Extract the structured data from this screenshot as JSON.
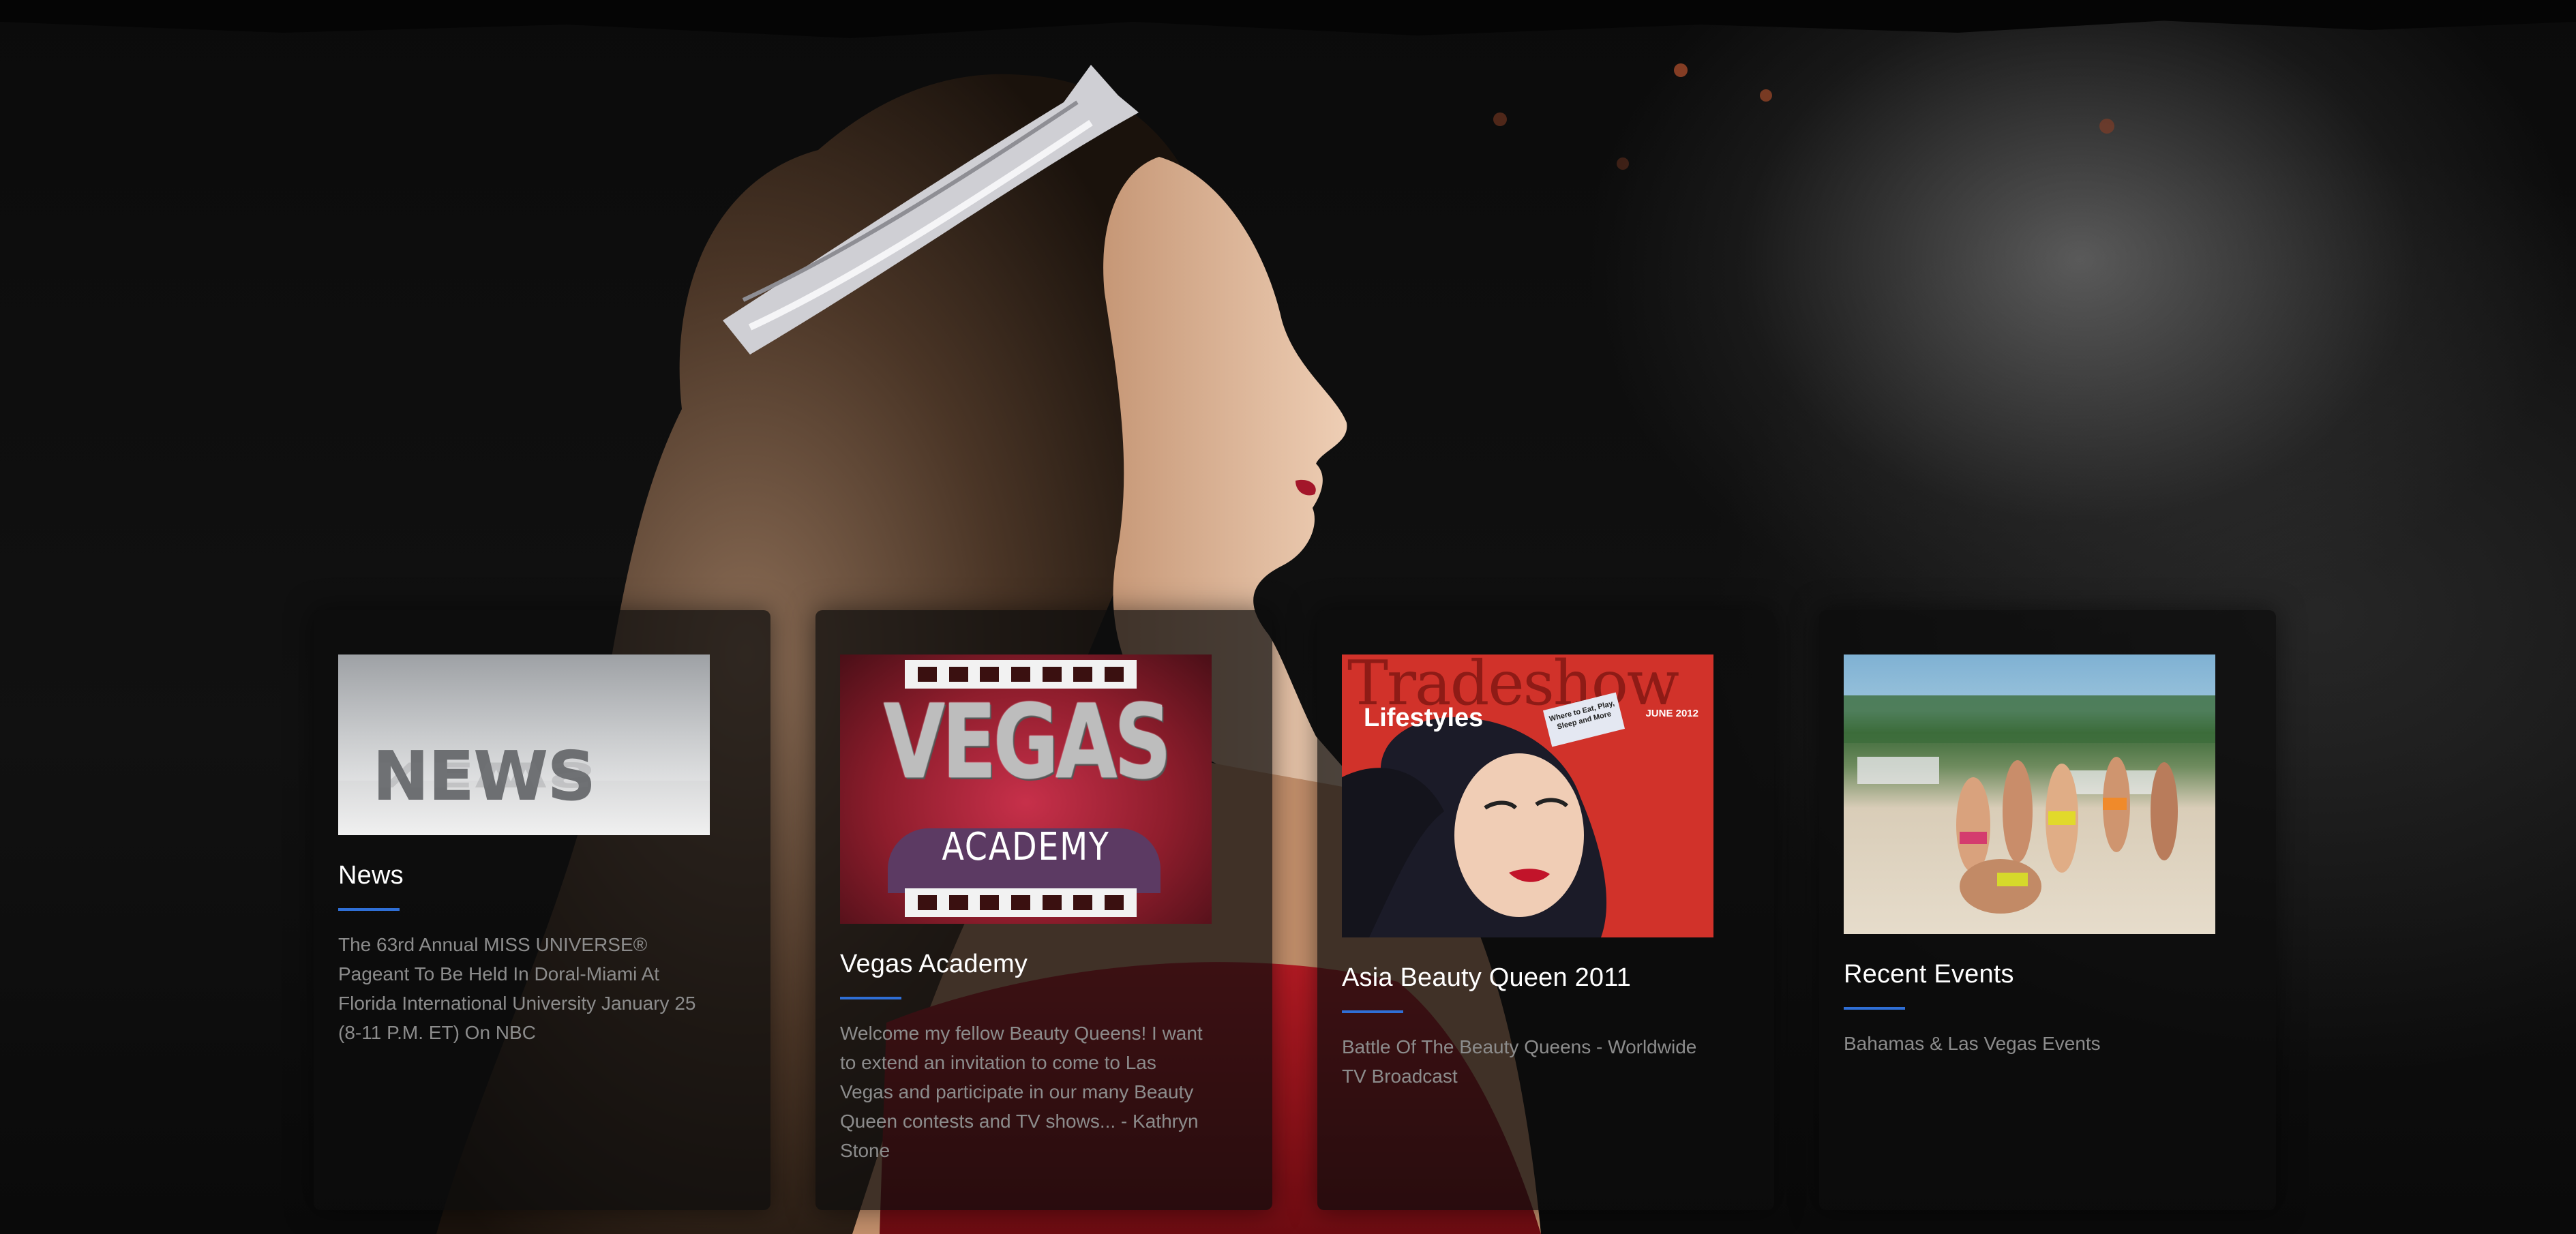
{
  "hero": {
    "background_color": "#050505",
    "accent_color": "#2f6fd6"
  },
  "cards": [
    {
      "image": {
        "kind": "news-graphic",
        "overlay_text": "NEWS"
      },
      "title": "News",
      "text": "The 63rd Annual MISS UNIVERSE® Pageant To Be Held In Doral-Miami At Florida International University January 25 (8-11 P.M. ET) On NBC"
    },
    {
      "image": {
        "kind": "vegas-academy-logo",
        "title_text": "VEGAS",
        "subtitle_text": "ACADEMY"
      },
      "title": "Vegas Academy",
      "text": "Welcome my fellow Beauty Queens! I want to extend an invitation to come to Las Vegas and participate in our many Beauty Queen contests and TV shows... - Kathryn Stone"
    },
    {
      "image": {
        "kind": "magazine-cover",
        "masthead": "Tradeshow",
        "section": "Lifestyles",
        "issue": "JUNE 2012",
        "sticker": "Where to Eat, Play, Sleep and More"
      },
      "title": "Asia Beauty Queen 2011",
      "text": "Battle Of The Beauty Queens - Worldwide TV Broadcast"
    },
    {
      "image": {
        "kind": "beach-photo"
      },
      "title": "Recent Events",
      "text": "Bahamas & Las Vegas Events"
    }
  ]
}
